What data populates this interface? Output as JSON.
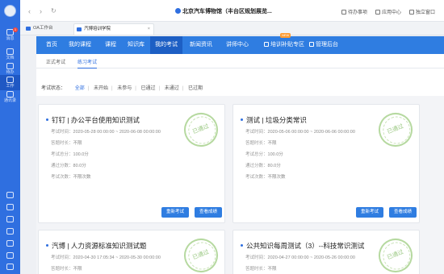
{
  "rail": {
    "items": [
      {
        "label": "消息",
        "badge": "1"
      },
      {
        "label": "文档"
      },
      {
        "label": "待办"
      },
      {
        "label": "工作"
      },
      {
        "label": "通讯录"
      }
    ]
  },
  "topbar": {
    "title": "北京汽车博物馆（丰台区规划展览...",
    "todo": "待办事项",
    "app": "应用中心",
    "standalone": "独立窗口"
  },
  "tabs": [
    {
      "label": "OA工作台"
    },
    {
      "label": "汽博培训学院",
      "close": "×"
    }
  ],
  "menu": {
    "items": [
      "首页",
      "我的课程",
      "课程",
      "知识库",
      "我的考试",
      "新闻资讯",
      "讲师中心",
      "培训补贴专区",
      "管理后台"
    ],
    "active_index": 4,
    "new_tag": "NEW"
  },
  "subtabs": [
    "正式考试",
    "练习考试"
  ],
  "filter": {
    "label": "考试状态：",
    "options": [
      "全部",
      "未开始",
      "未参与",
      "已通过",
      "未通过",
      "已过期"
    ],
    "active": "全部"
  },
  "cards": [
    {
      "title": "钉钉 | 办公平台使用知识测试",
      "rows": [
        {
          "label": "考试时间：",
          "value": "2020-05-28 00:00:00 ~ 2020-06-08 00:00:00"
        },
        {
          "label": "答题时长：",
          "value": "不限"
        },
        {
          "label": "考试总分：",
          "value": "100.0分"
        },
        {
          "label": "通过分数：",
          "value": "80.0分"
        },
        {
          "label": "考试次数：",
          "value": "不限次数"
        }
      ],
      "stamp": "已通过",
      "buttons": [
        "重新考试",
        "查看成绩"
      ]
    },
    {
      "title": "测试 | 垃圾分类常识",
      "rows": [
        {
          "label": "考试时间：",
          "value": "2020-05-06 00:00:00 ~ 2020-06-06 00:00:00"
        },
        {
          "label": "答题时长：",
          "value": "不限"
        },
        {
          "label": "考试总分：",
          "value": "100.0分"
        },
        {
          "label": "通过分数：",
          "value": "80.0分"
        },
        {
          "label": "考试次数：",
          "value": "不限次数"
        }
      ],
      "stamp": "已通过",
      "buttons": [
        "重新考试",
        "查看成绩"
      ]
    },
    {
      "title": "汽博 | 人力资源标准知识测试题",
      "rows": [
        {
          "label": "考试时间：",
          "value": "2020-04-30 17:05:34 ~ 2020-05-30 00:00:00"
        },
        {
          "label": "答题时长：",
          "value": "不限"
        }
      ],
      "stamp": "已通过"
    },
    {
      "title": "公共知识每周测试（3）--科技常识测试",
      "rows": [
        {
          "label": "考试时间：",
          "value": "2020-04-27 00:00:00 ~ 2020-05-26 00:00:00"
        },
        {
          "label": "答题时长：",
          "value": "不限"
        }
      ],
      "stamp": "已通过"
    }
  ]
}
